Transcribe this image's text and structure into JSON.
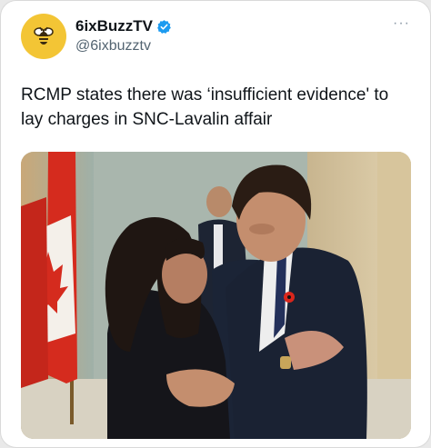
{
  "tweet": {
    "display_name": "6ixBuzzTV",
    "handle": "@6ixbuzztv",
    "text": "RCMP states there was ‘insufficient evidence' to lay charges in SNC-Lavalin affair",
    "more_label": "···"
  },
  "icons": {
    "avatar": "bee-logo-icon",
    "verified": "verified-badge-icon",
    "more": "more-options-icon"
  },
  "colors": {
    "avatar_bg": "#f3c535",
    "verified_blue": "#1d9bf0",
    "flag_red": "#d52b1e",
    "poppy_red": "#d9261c"
  }
}
